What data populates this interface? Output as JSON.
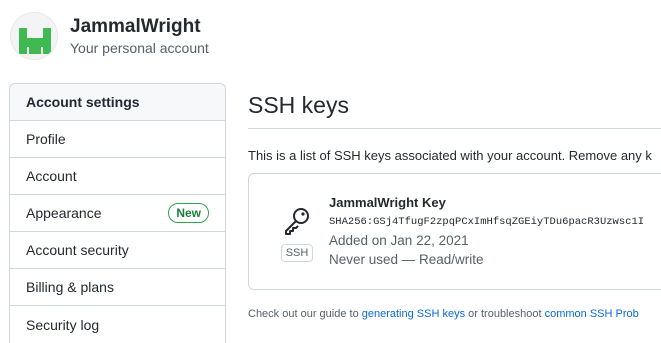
{
  "account": {
    "name": "JammalWright",
    "subtitle": "Your personal account"
  },
  "sidebar": {
    "items": [
      {
        "label": "Account settings"
      },
      {
        "label": "Profile"
      },
      {
        "label": "Account"
      },
      {
        "label": "Appearance",
        "badge": "New"
      },
      {
        "label": "Account security"
      },
      {
        "label": "Billing & plans"
      },
      {
        "label": "Security log"
      }
    ]
  },
  "main": {
    "title": "SSH keys",
    "intro": "This is a list of SSH keys associated with your account. Remove any k",
    "key": {
      "icon": "key-icon",
      "tag": "SSH",
      "name": "JammalWright Key",
      "fingerprint": "SHA256:GSj4TfugF2zpqPCxImHfsqZGEiyTDu6pacR3Uzwsc1I",
      "added": "Added on Jan 22, 2021",
      "usage": "Never used — Read/write"
    },
    "guide": {
      "prefix": "Check out our guide to ",
      "link1": "generating SSH keys",
      "middle": " or troubleshoot ",
      "link2": "common SSH Prob"
    }
  },
  "colors": {
    "avatar_green": "#3fb950",
    "badge_green": "#2da44e",
    "link_blue": "#0969da"
  }
}
